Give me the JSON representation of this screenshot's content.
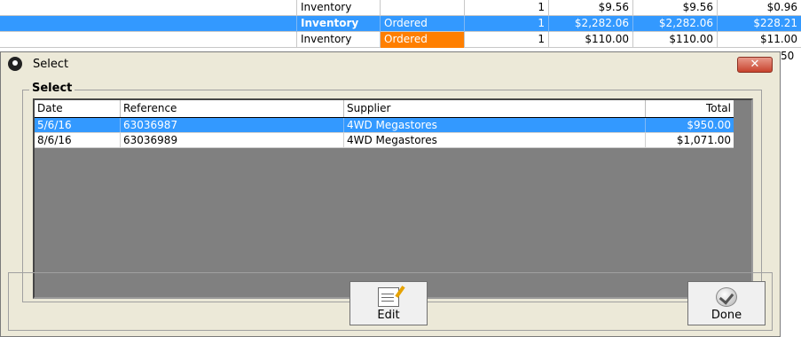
{
  "background_table": {
    "rows": [
      {
        "type": "Inventory",
        "status": "",
        "qty": "1",
        "price": "$9.56",
        "total": "$9.56",
        "tax": "$0.96"
      },
      {
        "type": "Inventory",
        "status": "Ordered",
        "qty": "1",
        "price": "$2,282.06",
        "total": "$2,282.06",
        "tax": "$228.21"
      },
      {
        "type": "Inventory",
        "status": "Ordered",
        "qty": "1",
        "price": "$110.00",
        "total": "$110.00",
        "tax": "$11.00"
      },
      {
        "partial": "50"
      }
    ]
  },
  "dialog": {
    "title": "Select",
    "close_label": "✕",
    "group_label": "Select",
    "columns": [
      "Date",
      "Reference",
      "Supplier",
      "Total"
    ],
    "rows": [
      {
        "date": "5/6/16",
        "reference": "63036987",
        "supplier": "4WD Megastores",
        "total": "$950.00"
      },
      {
        "date": "8/6/16",
        "reference": "63036989",
        "supplier": "4WD Megastores",
        "total": "$1,071.00"
      }
    ],
    "buttons": {
      "edit": "Edit",
      "done": "Done"
    }
  },
  "colors": {
    "selection": "#3399ff",
    "ordered_badge": "#ff7f00"
  }
}
